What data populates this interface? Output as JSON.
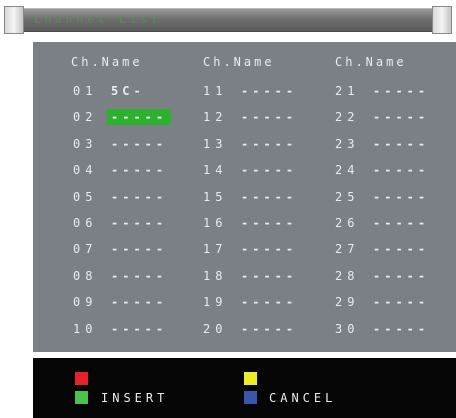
{
  "title": "Channel List",
  "header_label": "Ch.Name",
  "columns": [
    {
      "rows": [
        {
          "num": "01",
          "name": "5C-"
        },
        {
          "num": "02",
          "name": "-----",
          "selected": true
        },
        {
          "num": "03",
          "name": "-----"
        },
        {
          "num": "04",
          "name": "-----"
        },
        {
          "num": "05",
          "name": "-----"
        },
        {
          "num": "06",
          "name": "-----"
        },
        {
          "num": "07",
          "name": "-----"
        },
        {
          "num": "08",
          "name": "-----"
        },
        {
          "num": "09",
          "name": "-----"
        },
        {
          "num": "10",
          "name": "-----"
        }
      ]
    },
    {
      "rows": [
        {
          "num": "11",
          "name": "-----"
        },
        {
          "num": "12",
          "name": "-----"
        },
        {
          "num": "13",
          "name": "-----"
        },
        {
          "num": "14",
          "name": "-----"
        },
        {
          "num": "15",
          "name": "-----"
        },
        {
          "num": "16",
          "name": "-----"
        },
        {
          "num": "17",
          "name": "-----"
        },
        {
          "num": "18",
          "name": "-----"
        },
        {
          "num": "19",
          "name": "-----"
        },
        {
          "num": "20",
          "name": "-----"
        }
      ]
    },
    {
      "rows": [
        {
          "num": "21",
          "name": "-----"
        },
        {
          "num": "22",
          "name": "-----"
        },
        {
          "num": "23",
          "name": "-----"
        },
        {
          "num": "24",
          "name": "-----"
        },
        {
          "num": "25",
          "name": "-----"
        },
        {
          "num": "26",
          "name": "-----"
        },
        {
          "num": "27",
          "name": "-----"
        },
        {
          "num": "28",
          "name": "-----"
        },
        {
          "num": "29",
          "name": "-----"
        },
        {
          "num": "30",
          "name": "-----"
        }
      ]
    }
  ],
  "legend": {
    "insert_label": "INSERT",
    "cancel_label": "CANCEL",
    "colors": {
      "red": "#e8202a",
      "yellow": "#ecec2c",
      "green": "#4cc04c",
      "blue": "#3a56a8"
    }
  },
  "colors": {
    "panel": "#7b8086",
    "selected": "#2db02d",
    "title_text": "#3fb03f"
  }
}
